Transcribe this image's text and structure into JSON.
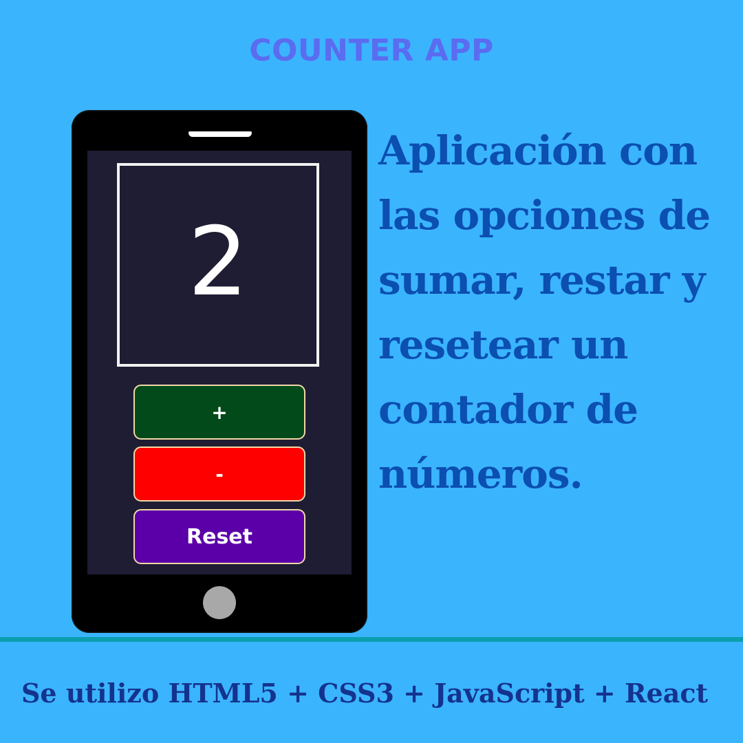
{
  "header": {
    "title": "COUNTER APP"
  },
  "phone": {
    "counter_value": "2",
    "buttons": {
      "plus": "+",
      "minus": "-",
      "reset": "Reset"
    }
  },
  "description": "Aplicación con las opciones de sumar, restar y resetear un contador de números.",
  "footer": {
    "text": "Se utilizo HTML5 + CSS3 + JavaScript + React"
  },
  "colors": {
    "background": "#3bb4fe",
    "title": "#5a6cf0",
    "plus_button": "#034a1a",
    "minus_button": "#ff0000",
    "reset_button": "#5b00a8",
    "description_text": "#0b4fb0"
  }
}
